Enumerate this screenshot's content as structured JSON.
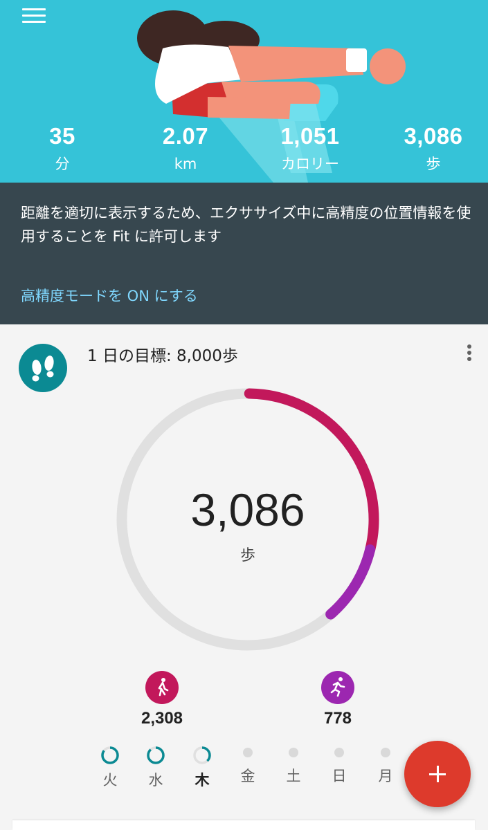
{
  "header": {
    "stats": [
      {
        "value": "35",
        "unit": "分"
      },
      {
        "value": "2.07",
        "unit": "km"
      },
      {
        "value": "1,051",
        "unit": "カロリー"
      },
      {
        "value": "3,086",
        "unit": "歩"
      }
    ]
  },
  "banner": {
    "message": "距離を適切に表示するため、エクササイズ中に高精度の位置情報を使用することを Fit に許可します",
    "action_label": "高精度モードを ON にする"
  },
  "goal": {
    "title": "1 日の目標: 8,000歩",
    "steps": "3,086",
    "unit": "歩",
    "progress_fraction": 0.3858,
    "walking_fraction": 0.2885,
    "running_fraction": 0.0973,
    "walking_steps": "2,308",
    "running_steps": "778",
    "colors": {
      "walking": "#c2185b",
      "running": "#9c27b0",
      "track": "#e0e0e0",
      "goal_icon": "#0b8a93"
    }
  },
  "week": [
    {
      "label": "火",
      "progress": 0.85,
      "current": false
    },
    {
      "label": "水",
      "progress": 0.88,
      "current": false
    },
    {
      "label": "木",
      "progress": 0.38,
      "current": true
    },
    {
      "label": "金",
      "progress": 0,
      "current": false
    },
    {
      "label": "土",
      "progress": 0,
      "current": false
    },
    {
      "label": "日",
      "progress": 0,
      "current": false
    },
    {
      "label": "月",
      "progress": 0,
      "current": false
    }
  ]
}
